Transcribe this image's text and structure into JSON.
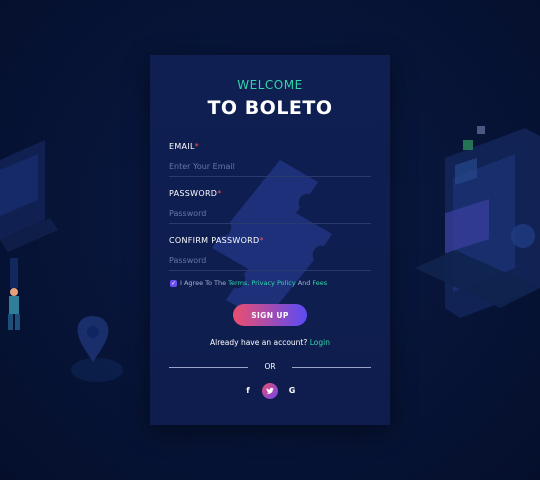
{
  "header": {
    "welcome": "WELCOME",
    "brand": "TO BOLETO"
  },
  "form": {
    "email": {
      "label": "EMAIL",
      "required_mark": "*",
      "placeholder": "Enter Your Email",
      "value": ""
    },
    "password": {
      "label": "PASSWORD",
      "required_mark": "*",
      "placeholder": "Password",
      "value": ""
    },
    "confirm_password": {
      "label": "CONFIRM PASSWORD",
      "required_mark": "*",
      "placeholder": "Password",
      "value": ""
    },
    "agree": {
      "checked": true,
      "prefix": "I Agree To The",
      "terms": "Terms,",
      "privacy": "Privacy Policy",
      "and": "And",
      "fees": "Fees"
    },
    "submit_label": "SIGN UP"
  },
  "login_prompt": {
    "text": "Already have an account?",
    "link": "Login"
  },
  "divider": {
    "text": "OR"
  },
  "social": [
    {
      "icon": "facebook-icon",
      "glyph": "f"
    },
    {
      "icon": "twitter-icon"
    },
    {
      "icon": "google-icon",
      "glyph": "G"
    }
  ],
  "colors": {
    "accent": "#31d7a9",
    "required": "#ff4f58",
    "button_gradient_start": "#ec4e6d",
    "button_gradient_end": "#5a4bf4",
    "card": "#0f1f52",
    "background": "#071437"
  }
}
